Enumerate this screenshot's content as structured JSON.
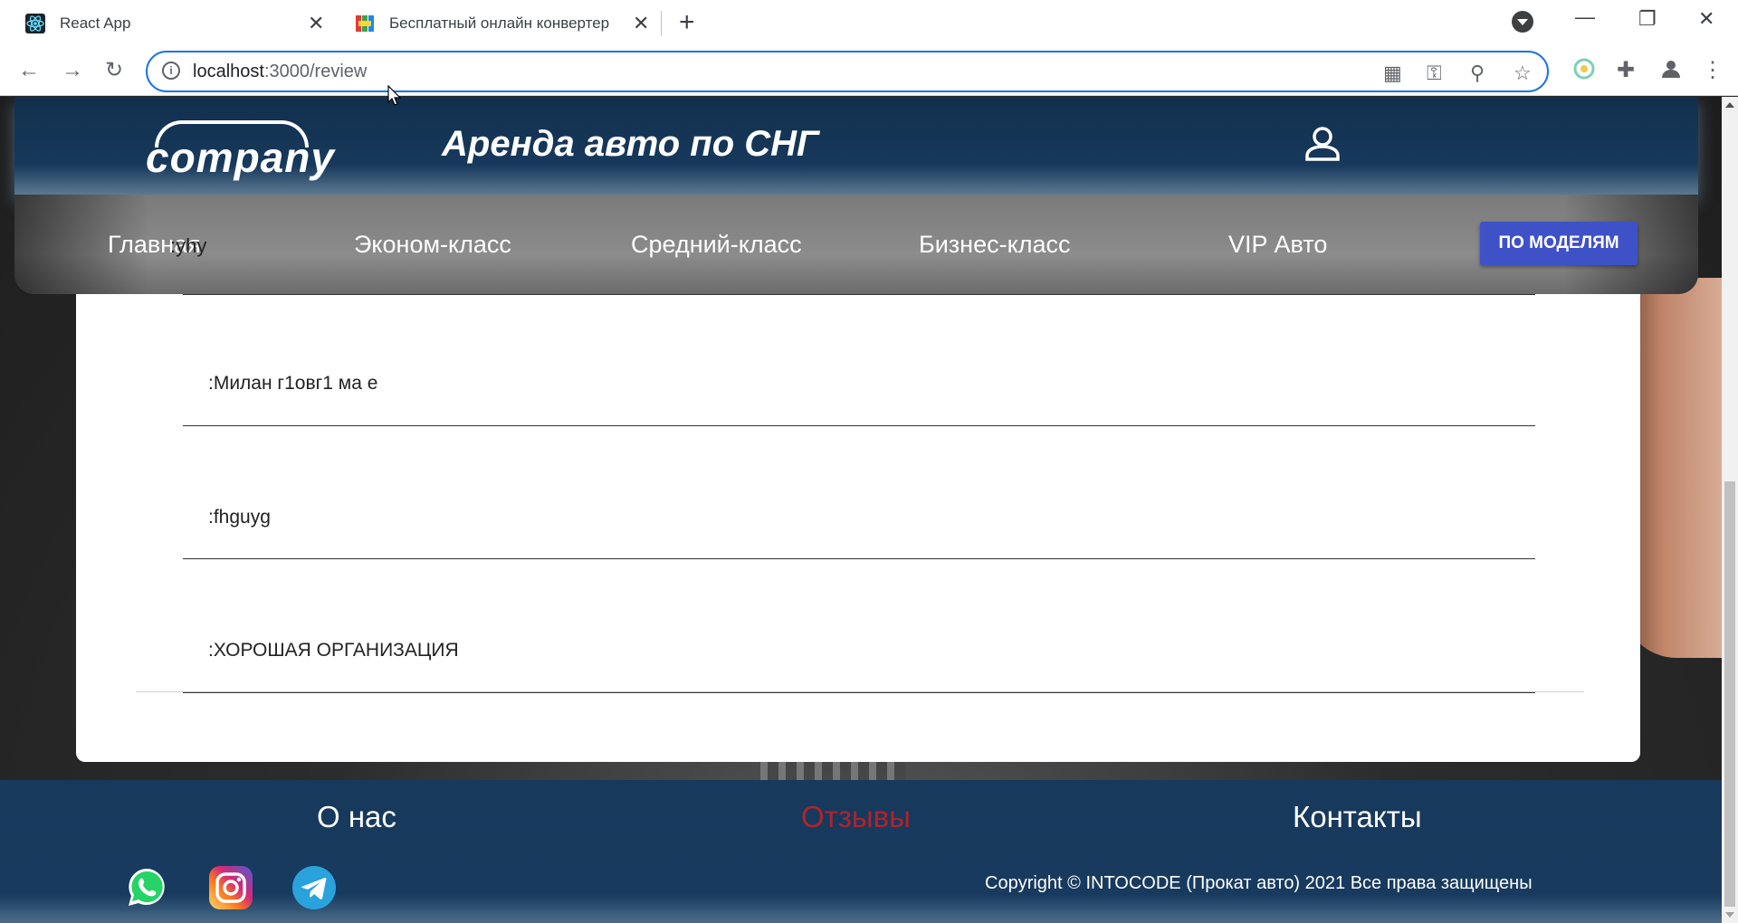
{
  "browser": {
    "tabs": [
      {
        "title": "React App",
        "icon": "react-icon"
      },
      {
        "title": "Бесплатный онлайн конвертер",
        "icon": "converter-icon"
      }
    ],
    "url_host": "localhost",
    "url_path": ":3000/review"
  },
  "header": {
    "logo_text": "company",
    "title": "Аренда авто по СНГ"
  },
  "nav": {
    "items": [
      "Главная",
      "Эконом-класс",
      "Средний-класс",
      "Бизнес-класс",
      "VIP Авто"
    ],
    "overlap_text": ":yhy",
    "models_button": "ПО МОДЕЛЯМ"
  },
  "reviews": [
    {
      "text": ":Милан г1овг1 ма е"
    },
    {
      "text": ":fhguyg"
    },
    {
      "text": ":ХОРОШАЯ ОРГАНИЗАЦИЯ"
    }
  ],
  "footer": {
    "links": [
      {
        "label": "О нас",
        "color": "#ffffff"
      },
      {
        "label": "Отзывы",
        "color": "#b2232a"
      },
      {
        "label": "Контакты",
        "color": "#ffffff"
      }
    ],
    "socials": [
      "whatsapp-icon",
      "instagram-icon",
      "telegram-icon"
    ],
    "copyright": "Copyright © INTOCODE (Прокат авто) 2021 Все права защищены"
  }
}
